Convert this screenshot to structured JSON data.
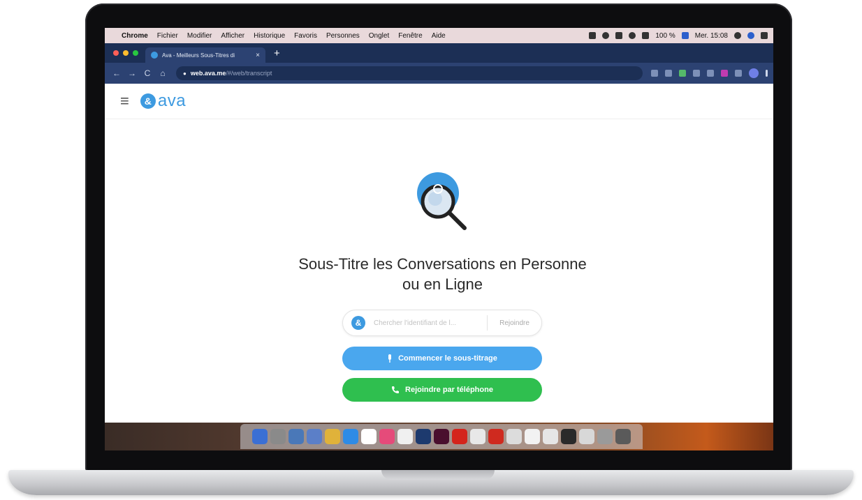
{
  "menubar": {
    "apple_glyph": "",
    "items": [
      "Chrome",
      "Fichier",
      "Modifier",
      "Afficher",
      "Historique",
      "Favoris",
      "Personnes",
      "Onglet",
      "Fenêtre",
      "Aide"
    ],
    "battery": "100 %",
    "datetime": "Mer. 15:08"
  },
  "browser": {
    "tab_title": "Ava - Meilleurs Sous-Titres di",
    "tab_close": "×",
    "new_tab": "+",
    "nav_back": "←",
    "nav_forward": "→",
    "nav_reload": "C",
    "nav_home": "⌂",
    "url_host": "web.ava.me",
    "url_path": "/#/web/transcript"
  },
  "header": {
    "menu_glyph": "≡",
    "logo_mark": "&",
    "logo_text": "ava"
  },
  "main": {
    "headline_line1": "Sous-Titre les Conversations en Personne",
    "headline_line2": "ou en Ligne",
    "join_logo": "&",
    "search_placeholder": "Chercher l'identifiant de l...",
    "join_label": "Rejoindre",
    "start_label": "Commencer le sous-titrage",
    "phone_label": "Rejoindre par téléphone"
  },
  "dock": {
    "colors": [
      "#3b6fd4",
      "#8a8a8a",
      "#4a78b8",
      "#5b7fc8",
      "#e0b23a",
      "#2e8be6",
      "#ffffff",
      "#e54b7a",
      "#f0f0f0",
      "#1d3a6e",
      "#4a0f2e",
      "#d4241c",
      "#e8e8e8",
      "#cf2a1f",
      "#dcdcdc",
      "#f2f2f2",
      "#e6e6e6",
      "#2a2a2a",
      "#d8d8d8",
      "#9a9a9a",
      "#5a5a5a"
    ]
  },
  "colors": {
    "brand_blue": "#3d9ae0",
    "start_button": "#4aa7ee",
    "phone_button": "#2fbf4f",
    "browser_chrome": "#1c2f55"
  }
}
